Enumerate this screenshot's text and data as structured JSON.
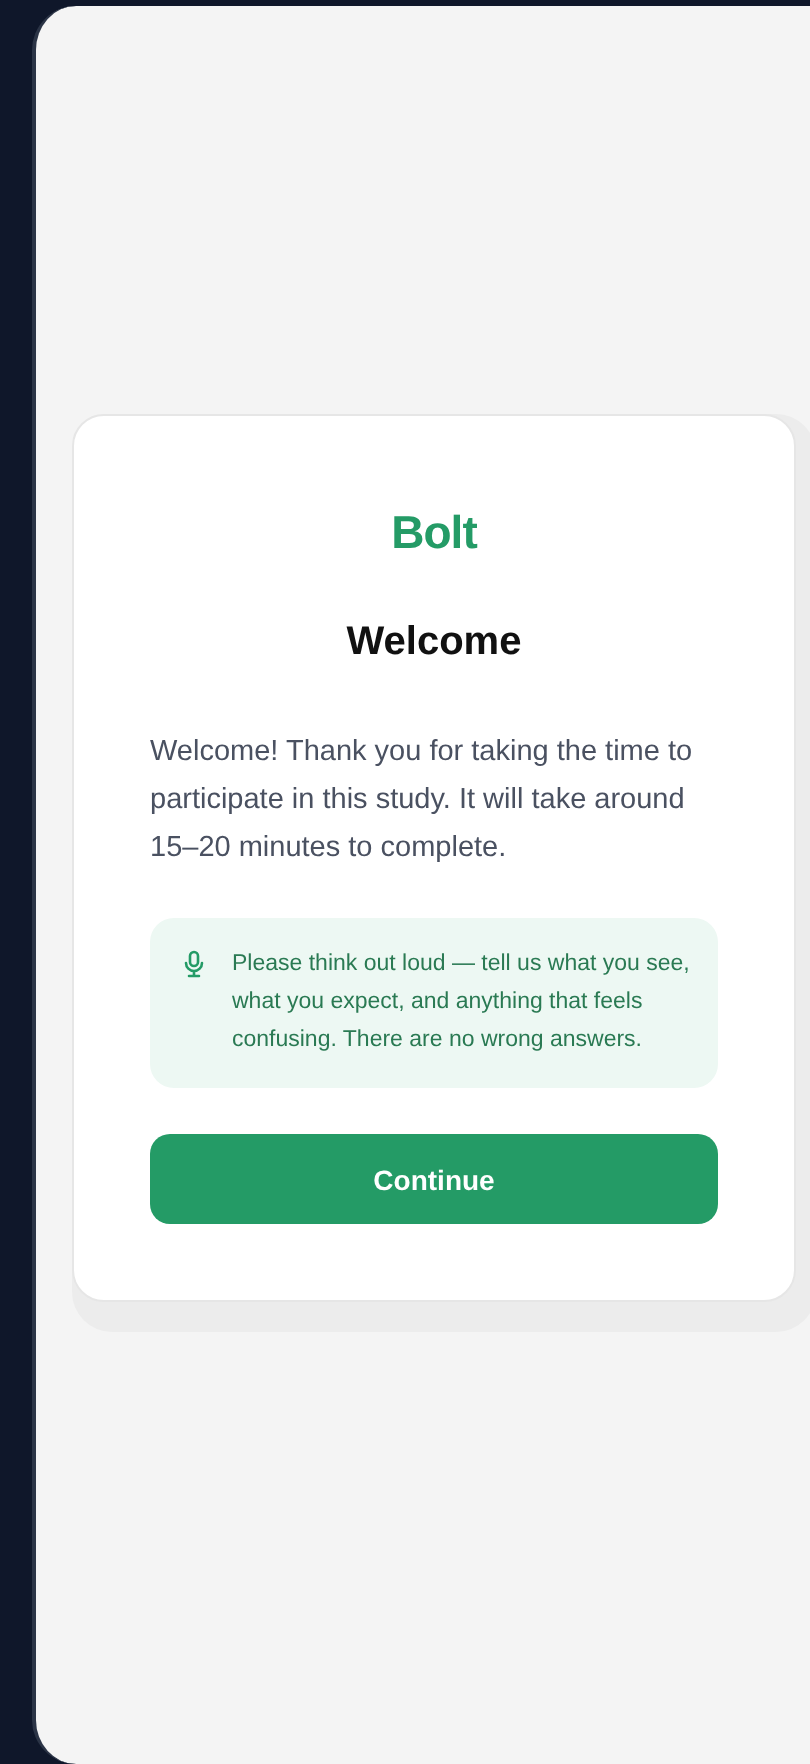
{
  "logo": {
    "text": "Bolt"
  },
  "title": "Welcome",
  "intro": "Welcome! Thank you for taking the time to participate in this study. It will take around 15–20 minutes to complete.",
  "tip": {
    "text": "Please think out loud — tell us what you see, what you expect, and anything that feels confusing. There are no wrong answers."
  },
  "button": {
    "label": "Continue"
  }
}
